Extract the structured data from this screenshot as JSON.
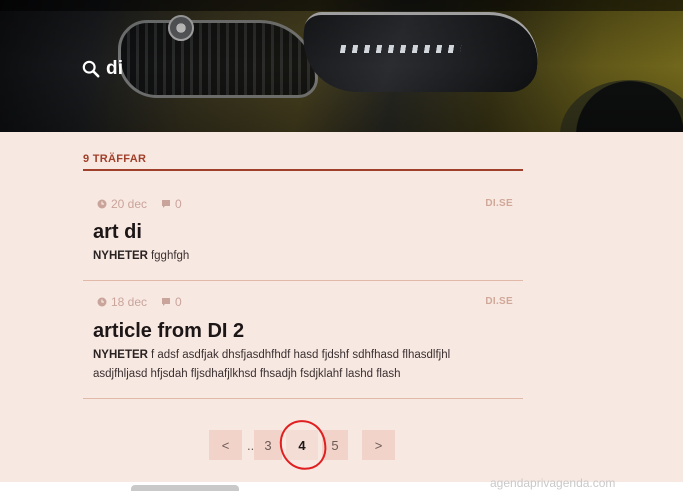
{
  "search": {
    "query": "di",
    "icon": "search-icon"
  },
  "results_header": {
    "count_label": "9 TRÄFFAR"
  },
  "results": [
    {
      "date": "20 dec",
      "comments": "0",
      "source": "DI.SE",
      "title": "art di",
      "category": "NYHETER",
      "excerpt": "fgghfgh"
    },
    {
      "date": "18 dec",
      "comments": "0",
      "source": "DI.SE",
      "title": "article from DI 2",
      "category": "NYHETER",
      "excerpt": "f adsf asdfjak dhsfjasdhfhdf hasd fjdshf sdhfhasd flhasdlfjhl asdjfhljasd hfjsdah fljsdhafjlkhsd fhsadjh fsdjklahf lashd flash"
    }
  ],
  "pagination": {
    "prev": "<",
    "ellipsis": "...",
    "pages": [
      "3",
      "4",
      "5"
    ],
    "current": "4",
    "next": ">"
  },
  "footer": {
    "ghost_text": "agendaprivagenda.com"
  },
  "colors": {
    "accent": "#a0402a",
    "background": "#f8e8e2",
    "highlight": "#e02020"
  }
}
